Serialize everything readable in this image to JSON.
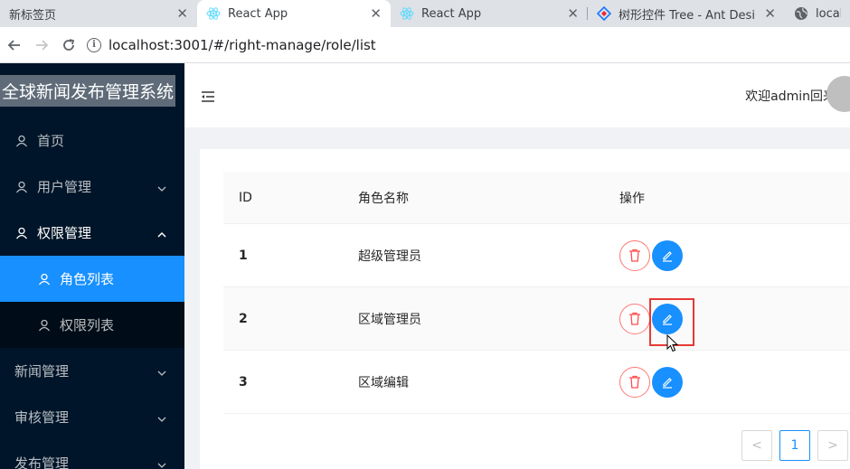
{
  "browser": {
    "tabs": [
      {
        "title": "新标签页",
        "favicon": "none",
        "active": false
      },
      {
        "title": "React App",
        "favicon": "react-icon",
        "active": true
      },
      {
        "title": "React App",
        "favicon": "react-icon",
        "active": false
      },
      {
        "title": "树形控件 Tree - Ant Desi",
        "favicon": "antd-icon",
        "active": false
      },
      {
        "title": "localh",
        "favicon": "globe-icon",
        "active": false
      }
    ],
    "close_glyph": "✕",
    "url": "localhost:3001/#/right-manage/role/list"
  },
  "sidebar": {
    "logo": "全球新闻发布管理系统",
    "items": [
      {
        "label": "首页",
        "icon": "user-icon"
      },
      {
        "label": "用户管理",
        "icon": "user-icon",
        "expandable": true
      },
      {
        "label": "权限管理",
        "icon": "user-icon",
        "expanded": true
      },
      {
        "label": "新闻管理",
        "expandable": true
      },
      {
        "label": "审核管理",
        "expandable": true
      },
      {
        "label": "发布管理",
        "expandable": true
      }
    ],
    "submenu": [
      {
        "label": "角色列表",
        "icon": "user-icon",
        "selected": true
      },
      {
        "label": "权限列表",
        "icon": "user-icon"
      }
    ]
  },
  "header": {
    "welcome": "欢迎admin回来"
  },
  "table": {
    "columns": [
      "ID",
      "角色名称",
      "操作"
    ],
    "rows": [
      {
        "id": "1",
        "name": "超级管理员"
      },
      {
        "id": "2",
        "name": "区域管理员"
      },
      {
        "id": "3",
        "name": "区域编辑"
      }
    ]
  },
  "pagination": {
    "prev": "<",
    "current": "1",
    "next": ">"
  },
  "colors": {
    "primary": "#1890ff",
    "danger": "#ff4d4f",
    "sider": "#001529",
    "annotation": "#e53935"
  }
}
